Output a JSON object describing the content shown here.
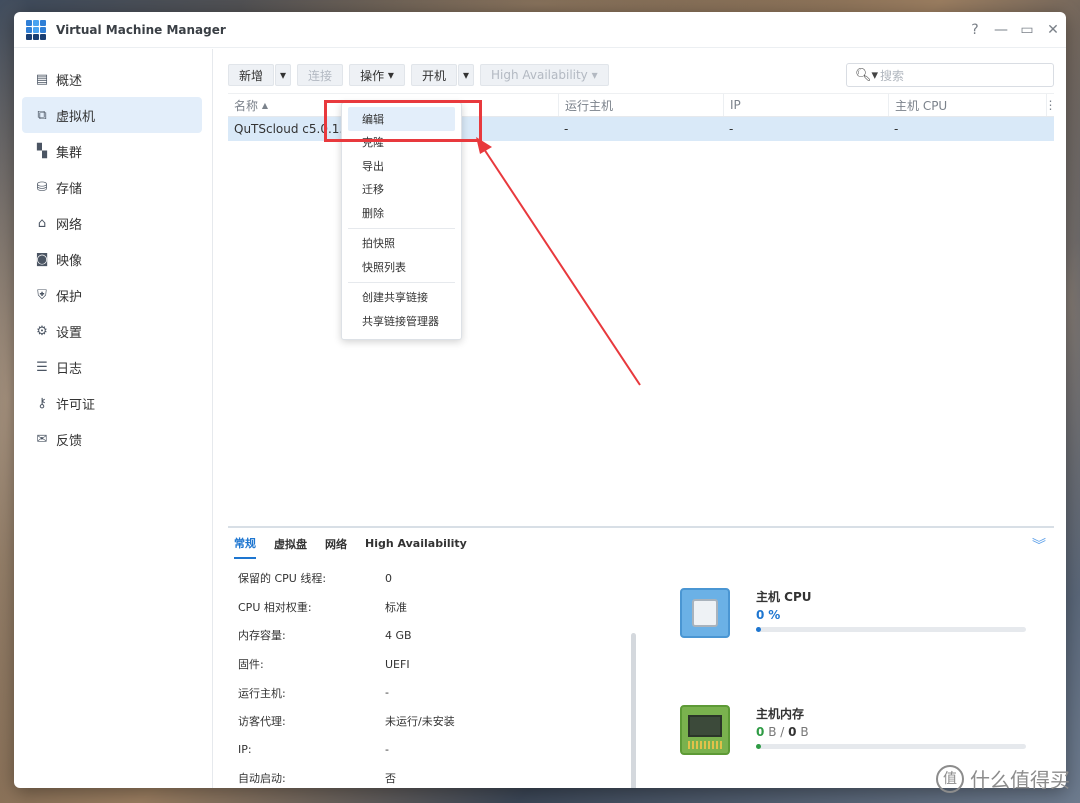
{
  "window": {
    "title": "Virtual Machine Manager"
  },
  "sidebar": {
    "items": [
      {
        "label": "概述",
        "icon": "overview-icon"
      },
      {
        "label": "虚拟机",
        "icon": "vm-icon"
      },
      {
        "label": "集群",
        "icon": "cluster-icon"
      },
      {
        "label": "存储",
        "icon": "storage-icon"
      },
      {
        "label": "网络",
        "icon": "network-icon"
      },
      {
        "label": "映像",
        "icon": "image-icon"
      },
      {
        "label": "保护",
        "icon": "shield-icon"
      },
      {
        "label": "设置",
        "icon": "gear-icon"
      },
      {
        "label": "日志",
        "icon": "log-icon"
      },
      {
        "label": "许可证",
        "icon": "key-icon"
      },
      {
        "label": "反馈",
        "icon": "mail-icon"
      }
    ],
    "active": "虚拟机"
  },
  "toolbar": {
    "new_label": "新增",
    "connect_label": "连接",
    "action_label": "操作",
    "power_label": "开机",
    "ha_label": "High Availability",
    "search_placeholder": "搜索"
  },
  "grid": {
    "columns": [
      "名称",
      "运行主机",
      "IP",
      "主机 CPU"
    ],
    "rows": [
      {
        "name": "QuTScloud c5.0.1.2",
        "host": "-",
        "ip": "-",
        "cpu": "-"
      }
    ]
  },
  "dropdown": {
    "group1": [
      "编辑",
      "克隆",
      "导出",
      "迁移",
      "删除"
    ],
    "group2": [
      "拍快照",
      "快照列表"
    ],
    "group3": [
      "创建共享链接",
      "共享链接管理器"
    ]
  },
  "detail": {
    "tabs": [
      "常规",
      "虚拟盘",
      "网络",
      "High Availability"
    ],
    "active_tab": "常规",
    "props": [
      {
        "label": "保留的 CPU 线程:",
        "value": "0"
      },
      {
        "label": "CPU 相对权重:",
        "value": "标准"
      },
      {
        "label": "内存容量:",
        "value": "4 GB"
      },
      {
        "label": "固件:",
        "value": "UEFI"
      },
      {
        "label": "运行主机:",
        "value": "-"
      },
      {
        "label": "访客代理:",
        "value": "未运行/未安装"
      },
      {
        "label": "IP:",
        "value": "-"
      },
      {
        "label": "自动启动:",
        "value": "否"
      }
    ],
    "cpu": {
      "title": "主机 CPU",
      "value": "0",
      "unit": "%",
      "fill_fraction": 0.02,
      "color": "#1e76d0"
    },
    "memory": {
      "title": "主机内存",
      "used": "0",
      "used_unit": "B",
      "sep": "/",
      "total": "0",
      "total_unit": "B",
      "fill_fraction": 0.02,
      "color": "#2e9b44"
    }
  },
  "watermark": {
    "text": "什么值得买",
    "logo": "值"
  }
}
